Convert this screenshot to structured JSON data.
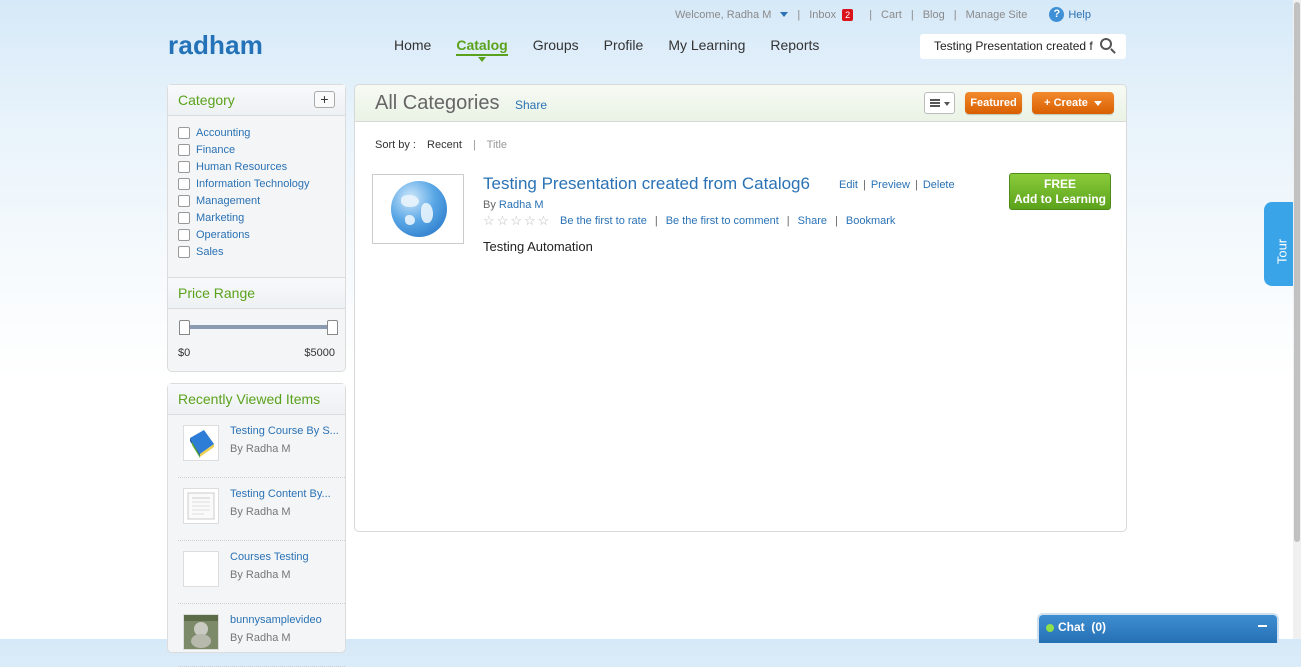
{
  "topbar": {
    "welcome": "Welcome, Radha M",
    "inbox_label": "Inbox",
    "inbox_count": "2",
    "cart": "Cart",
    "blog": "Blog",
    "manage_site": "Manage Site",
    "help": "Help"
  },
  "logo": "radham",
  "nav": {
    "items": [
      "Home",
      "Catalog",
      "Groups",
      "Profile",
      "My Learning",
      "Reports"
    ],
    "active": "Catalog"
  },
  "search": {
    "value": "Testing Presentation created f"
  },
  "sidebar": {
    "category_title": "Category",
    "add_label": "+",
    "categories": [
      "Accounting",
      "Finance",
      "Human Resources",
      "Information Technology",
      "Management",
      "Marketing",
      "Operations",
      "Sales"
    ],
    "price_title": "Price Range",
    "price_min": "$0",
    "price_max": "$5000",
    "recent_title": "Recently Viewed Items",
    "recent": [
      {
        "title": "Testing Course By S...",
        "by": "By Radha M",
        "thumb": "book-icon"
      },
      {
        "title": "Testing Content By...",
        "by": "By Radha M",
        "thumb": "document-icon"
      },
      {
        "title": "Courses Testing",
        "by": "By Radha M",
        "thumb": "blank-icon"
      },
      {
        "title": "bunnysamplevideo",
        "by": "By Radha M",
        "thumb": "video-icon"
      }
    ]
  },
  "main": {
    "title": "All Categories",
    "share": "Share",
    "featured": "Featured",
    "create": "+ Create",
    "sort_label": "Sort by :",
    "sort_recent": "Recent",
    "sort_title": "Title",
    "item": {
      "title": "Testing Presentation created from Catalog6",
      "edit": "Edit",
      "preview": "Preview",
      "delete": "Delete",
      "by_prefix": "By",
      "author": "Radha M",
      "rate": "Be the first to rate",
      "comment": "Be the first to comment",
      "share": "Share",
      "bookmark": "Bookmark",
      "description": "Testing Automation",
      "btn_line1": "FREE",
      "btn_line2": "Add to Learning",
      "thumb": "globe-icon"
    }
  },
  "tour": "Tour",
  "chat": {
    "label": "Chat",
    "count": "(0)"
  },
  "colors": {
    "brand_blue": "#2473b8",
    "accent_green": "#5ba21c",
    "orange": "#e8720c",
    "link": "#2a72b5"
  }
}
